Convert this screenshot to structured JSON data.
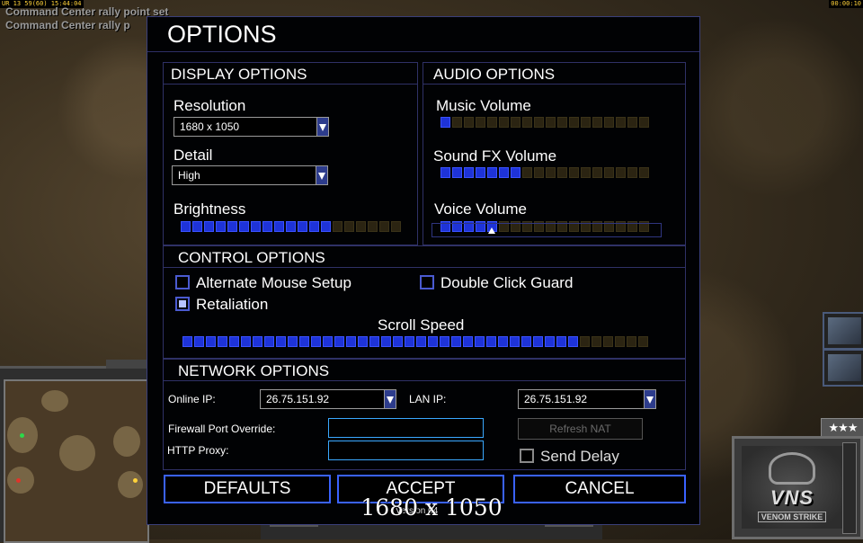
{
  "hud": {
    "top_left": "UR 13 59(60) 15:44:04",
    "top_right": "00:00:10",
    "messages": [
      "Command Center rally point set",
      "Command Center rally p"
    ]
  },
  "dialog": {
    "title": "OPTIONS",
    "display": {
      "title": "DISPLAY OPTIONS",
      "resolution_label": "Resolution",
      "resolution_value": "1680 x 1050",
      "detail_label": "Detail",
      "detail_value": "High",
      "brightness_label": "Brightness",
      "brightness_level": 0.7
    },
    "audio": {
      "title": "AUDIO OPTIONS",
      "music_label": "Music Volume",
      "music_level": 0.06,
      "sfx_label": "Sound FX Volume",
      "sfx_level": 0.39,
      "voice_label": "Voice Volume",
      "voice_level": 0.28
    },
    "control": {
      "title": "CONTROL OPTIONS",
      "alt_mouse_label": "Alternate Mouse Setup",
      "alt_mouse_checked": false,
      "double_click_label": "Double Click Guard",
      "double_click_checked": false,
      "retaliation_label": "Retaliation",
      "retaliation_checked": true,
      "scroll_label": "Scroll Speed",
      "scroll_level": 0.86
    },
    "network": {
      "title": "NETWORK OPTIONS",
      "online_ip_label": "Online IP:",
      "online_ip_value": "26.75.151.92",
      "lan_ip_label": "LAN IP:",
      "lan_ip_value": "26.75.151.92",
      "firewall_label": "Firewall Port Override:",
      "firewall_value": "",
      "http_proxy_label": "HTTP Proxy:",
      "http_proxy_value": "",
      "refresh_nat_label": "Refresh NAT",
      "send_delay_label": "Send Delay",
      "send_delay_checked": false
    },
    "buttons": {
      "defaults": "DEFAULTS",
      "accept": "ACCEPT",
      "cancel": "CANCEL"
    }
  },
  "overlay": {
    "resolution_text": "1680 x 1050",
    "version_text": "Version 04"
  },
  "side": {
    "rank_stars": "★★★",
    "logo_title": "VNS",
    "logo_subtitle": "VENOM STRIKE"
  },
  "colors": {
    "slider_on": "#1e33d8",
    "slider_off": "#2b2412",
    "accent_border": "#3a62ff"
  }
}
